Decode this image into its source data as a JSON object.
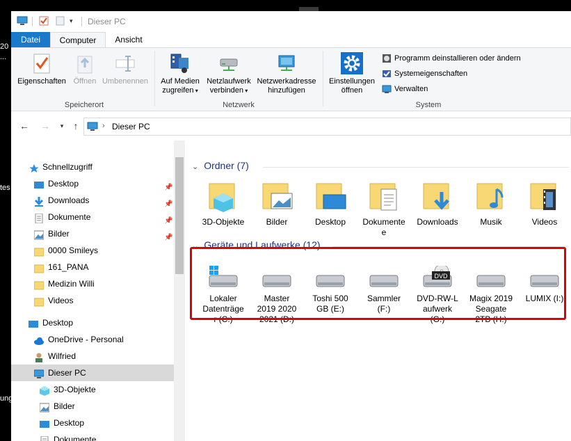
{
  "desktop": {
    "fragments": [
      "20",
      "...",
      "tes",
      "ung"
    ]
  },
  "window": {
    "title": "Dieser PC",
    "tabs": {
      "file": "Datei",
      "computer": "Computer",
      "view": "Ansicht"
    },
    "ribbon": {
      "location": {
        "properties": "Eigenschaften",
        "open": "Öffnen",
        "rename": "Umbenennen",
        "label": "Speicherort"
      },
      "network": {
        "access_media_1": "Auf Medien",
        "access_media_2": "zugreifen",
        "map_drive_1": "Netzlaufwerk",
        "map_drive_2": "verbinden",
        "add_location_1": "Netzwerkadresse",
        "add_location_2": "hinzufügen",
        "label": "Netzwerk"
      },
      "system": {
        "settings_1": "Einstellungen",
        "settings_2": "öffnen",
        "uninstall": "Programm deinstallieren oder ändern",
        "sysprops": "Systemeigenschaften",
        "manage": "Verwalten",
        "label": "System"
      }
    },
    "address": {
      "path": "Dieser PC"
    },
    "nav": {
      "quick_access": "Schnellzugriff",
      "qa_items": [
        "Desktop",
        "Downloads",
        "Dokumente",
        "Bilder",
        "0000 Smileys",
        "161_PANA",
        "Medizin Willi",
        "Videos"
      ],
      "desktop": "Desktop",
      "onedrive": "OneDrive - Personal",
      "user": "Wilfried",
      "this_pc": "Dieser PC",
      "pc_items": [
        "3D-Objekte",
        "Bilder",
        "Desktop",
        "Dokumente"
      ]
    },
    "content": {
      "folders_header": "Ordner (7)",
      "folders": [
        "3D-Objekte",
        "Bilder",
        "Desktop",
        "Dokumente",
        "Downloads",
        "Musik",
        "Videos"
      ],
      "drives_header": "Geräte und Laufwerke (12)",
      "drives": [
        [
          "Lokaler",
          "Datenträge",
          "r (C:)"
        ],
        [
          "Master",
          "2019 2020",
          "2021 (D:)"
        ],
        [
          "Toshi 500",
          "GB  (E:)"
        ],
        [
          "Sammler",
          "(F:)"
        ],
        [
          "DVD-RW-L",
          "aufwerk",
          "(G:)"
        ],
        [
          "Magix 2019",
          "Seagate",
          "2TB (H:)"
        ],
        [
          "LUMIX (I:)"
        ]
      ],
      "dvd_badge": "DVD"
    }
  },
  "colors": {
    "accent": "#1979ca",
    "highlight": "#e00000",
    "section": "#1e3287",
    "selected": "#d9d9d9"
  }
}
